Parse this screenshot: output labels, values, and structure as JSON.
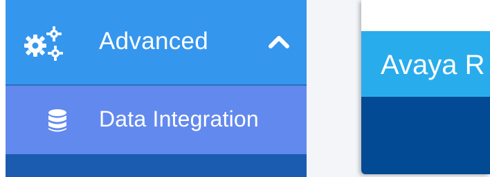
{
  "sidebar": {
    "advanced": {
      "label": "Advanced",
      "icon": "gears-icon",
      "chevron": "chevron-up-icon"
    },
    "items": [
      {
        "label": "Data Integration",
        "icon": "database-icon"
      }
    ]
  },
  "card": {
    "title": "Avaya R"
  },
  "colors": {
    "sidebar_active": "#3596ee",
    "sidebar_subitem": "#6289ee",
    "sidebar_bottom": "#1c5cb0",
    "card_header": "#29acec",
    "card_body": "#024a93"
  }
}
